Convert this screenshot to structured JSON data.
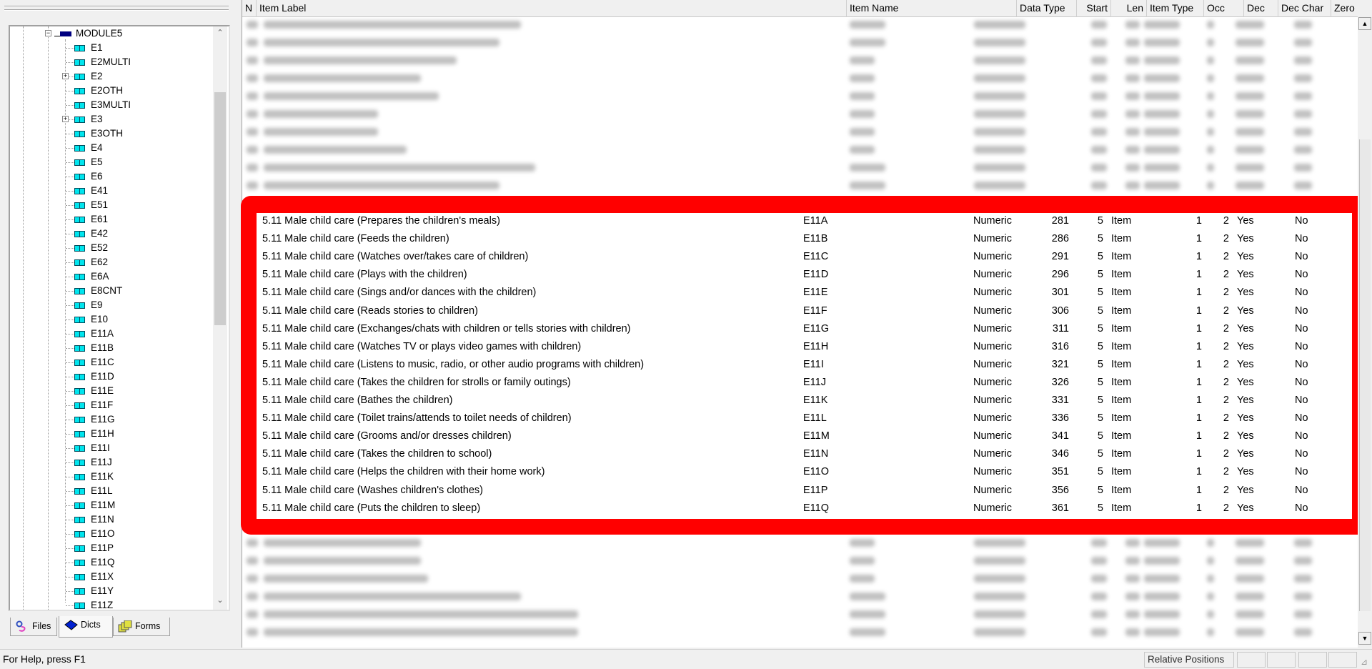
{
  "tree": {
    "root": {
      "label": "MODULE5",
      "expanded": true
    },
    "items": [
      {
        "label": "E1",
        "has_children": false
      },
      {
        "label": "E2MULTI",
        "has_children": false
      },
      {
        "label": "E2",
        "has_children": true
      },
      {
        "label": "E2OTH",
        "has_children": false
      },
      {
        "label": "E3MULTI",
        "has_children": false
      },
      {
        "label": "E3",
        "has_children": true
      },
      {
        "label": "E3OTH",
        "has_children": false
      },
      {
        "label": "E4",
        "has_children": false
      },
      {
        "label": "E5",
        "has_children": false
      },
      {
        "label": "E6",
        "has_children": false
      },
      {
        "label": "E41",
        "has_children": false
      },
      {
        "label": "E51",
        "has_children": false
      },
      {
        "label": "E61",
        "has_children": false
      },
      {
        "label": "E42",
        "has_children": false
      },
      {
        "label": "E52",
        "has_children": false
      },
      {
        "label": "E62",
        "has_children": false
      },
      {
        "label": "E6A",
        "has_children": false
      },
      {
        "label": "E8CNT",
        "has_children": false
      },
      {
        "label": "E9",
        "has_children": false
      },
      {
        "label": "E10",
        "has_children": false
      },
      {
        "label": "E11A",
        "has_children": false
      },
      {
        "label": "E11B",
        "has_children": false
      },
      {
        "label": "E11C",
        "has_children": false
      },
      {
        "label": "E11D",
        "has_children": false
      },
      {
        "label": "E11E",
        "has_children": false
      },
      {
        "label": "E11F",
        "has_children": false
      },
      {
        "label": "E11G",
        "has_children": false
      },
      {
        "label": "E11H",
        "has_children": false
      },
      {
        "label": "E11I",
        "has_children": false
      },
      {
        "label": "E11J",
        "has_children": false
      },
      {
        "label": "E11K",
        "has_children": false
      },
      {
        "label": "E11L",
        "has_children": false
      },
      {
        "label": "E11M",
        "has_children": false
      },
      {
        "label": "E11N",
        "has_children": false
      },
      {
        "label": "E11O",
        "has_children": false
      },
      {
        "label": "E11P",
        "has_children": false
      },
      {
        "label": "E11Q",
        "has_children": false
      },
      {
        "label": "E11X",
        "has_children": false
      },
      {
        "label": "E11Y",
        "has_children": false
      },
      {
        "label": "E11Z",
        "has_children": false
      }
    ]
  },
  "tabs": [
    {
      "label": "Files",
      "icon": "files-icon",
      "active": false
    },
    {
      "label": "Dicts",
      "icon": "book-icon",
      "active": true
    },
    {
      "label": "Forms",
      "icon": "forms-icon",
      "active": false
    }
  ],
  "grid": {
    "columns": [
      "N",
      "Item Label",
      "Item Name",
      "Data Type",
      "Start",
      "Len",
      "Item Type",
      "Occ",
      "Dec",
      "Dec Char",
      "Zero Fill"
    ],
    "rows": [
      [
        "5.11 Male child care (Prepares the children's meals)",
        "E11A",
        "Numeric",
        "281",
        "5",
        "Item",
        "1",
        "2",
        "Yes",
        "No"
      ],
      [
        "5.11 Male child care (Feeds the children)",
        "E11B",
        "Numeric",
        "286",
        "5",
        "Item",
        "1",
        "2",
        "Yes",
        "No"
      ],
      [
        "5.11 Male child care (Watches over/takes care of children)",
        "E11C",
        "Numeric",
        "291",
        "5",
        "Item",
        "1",
        "2",
        "Yes",
        "No"
      ],
      [
        "5.11 Male child care (Plays with the children)",
        "E11D",
        "Numeric",
        "296",
        "5",
        "Item",
        "1",
        "2",
        "Yes",
        "No"
      ],
      [
        "5.11 Male child care (Sings and/or dances with the children)",
        "E11E",
        "Numeric",
        "301",
        "5",
        "Item",
        "1",
        "2",
        "Yes",
        "No"
      ],
      [
        "5.11 Male child care (Reads stories to children)",
        "E11F",
        "Numeric",
        "306",
        "5",
        "Item",
        "1",
        "2",
        "Yes",
        "No"
      ],
      [
        "5.11 Male child care (Exchanges/chats with children or tells stories with children)",
        "E11G",
        "Numeric",
        "311",
        "5",
        "Item",
        "1",
        "2",
        "Yes",
        "No"
      ],
      [
        "5.11 Male child care (Watches TV or plays video games with children)",
        "E11H",
        "Numeric",
        "316",
        "5",
        "Item",
        "1",
        "2",
        "Yes",
        "No"
      ],
      [
        "5.11 Male child care (Listens to music, radio, or other audio programs with children)",
        "E11I",
        "Numeric",
        "321",
        "5",
        "Item",
        "1",
        "2",
        "Yes",
        "No"
      ],
      [
        "5.11 Male child care (Takes the children for strolls or family outings)",
        "E11J",
        "Numeric",
        "326",
        "5",
        "Item",
        "1",
        "2",
        "Yes",
        "No"
      ],
      [
        "5.11 Male child care (Bathes the children)",
        "E11K",
        "Numeric",
        "331",
        "5",
        "Item",
        "1",
        "2",
        "Yes",
        "No"
      ],
      [
        "5.11 Male child care (Toilet trains/attends to toilet needs of children)",
        "E11L",
        "Numeric",
        "336",
        "5",
        "Item",
        "1",
        "2",
        "Yes",
        "No"
      ],
      [
        "5.11 Male child care (Grooms and/or dresses children)",
        "E11M",
        "Numeric",
        "341",
        "5",
        "Item",
        "1",
        "2",
        "Yes",
        "No"
      ],
      [
        "5.11 Male child care (Takes the children to school)",
        "E11N",
        "Numeric",
        "346",
        "5",
        "Item",
        "1",
        "2",
        "Yes",
        "No"
      ],
      [
        "5.11 Male child care (Helps the children with their home work)",
        "E11O",
        "Numeric",
        "351",
        "5",
        "Item",
        "1",
        "2",
        "Yes",
        "No"
      ],
      [
        "5.11 Male child care (Washes children's clothes)",
        "E11P",
        "Numeric",
        "356",
        "5",
        "Item",
        "1",
        "2",
        "Yes",
        "No"
      ],
      [
        "5.11 Male child care (Puts the children to sleep)",
        "E11Q",
        "Numeric",
        "361",
        "5",
        "Item",
        "1",
        "2",
        "Yes",
        "No"
      ]
    ],
    "highlight_color": "#ff0000"
  },
  "status": {
    "help_text": "For Help, press F1",
    "mode": "Relative Positions"
  }
}
